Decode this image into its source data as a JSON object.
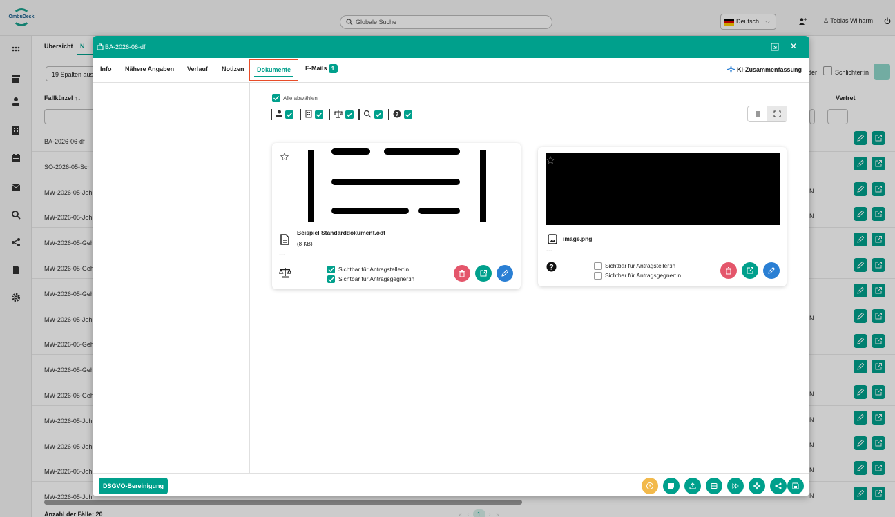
{
  "app": {
    "logo_text": "OmbuDesk"
  },
  "topbar": {
    "search_placeholder": "Globale Suche",
    "language": "Deutsch",
    "user_name": "Tobias Wilharm"
  },
  "list": {
    "tab_overview": "Übersicht",
    "tab_second": "N",
    "column_select": "19 Spalten aus",
    "col_fallkuerzel": "Fallkürzel ↑↓",
    "col_vertreter": "Vertret",
    "filter_der": "der",
    "filter_schlichter": "Schlichter:in",
    "rows": [
      "BA-2026-06-df",
      "SO-2026-05-Sch",
      "MW-2026-05-Joh",
      "MW-2026-05-Joh",
      "MW-2026-05-Geh",
      "MW-2026-05-Geh",
      "MW-2026-05-Geh",
      "MW-2026-05-Joh",
      "MW-2026-05-Geh",
      "MW-2026-05-Geh",
      "MW-2026-05-Geh",
      "MW-2026-05-Joh",
      "MW-2026-05-Joh",
      "MW-2026-05-Joh",
      "MW-2026-05-Joh"
    ],
    "n_mark": "N",
    "count_label": "Anzahl der Fälle: 20",
    "page_current": "1"
  },
  "modal": {
    "title": "BA-2026-06-df",
    "tabs": {
      "info": "Info",
      "details": "Nähere Angaben",
      "history": "Verlauf",
      "notes": "Notizen",
      "documents": "Dokumente",
      "emails": "E-Mails",
      "emails_count": "1"
    },
    "ki_summary": "KI-Zusammenfassung",
    "select_all": "Alle abwählen",
    "dsgvo_button": "DSGVO-Bereinigung",
    "documents": [
      {
        "name": "Beispiel Standarddokument.odt",
        "size": "(8 KB)",
        "note": "---",
        "visible_applicant_label": "Sichtbar für Antragsteller:in",
        "visible_applicant": true,
        "visible_opponent_label": "Sichtbar für Antragsgegner:in",
        "visible_opponent": true,
        "category_icon": "scale-icon"
      },
      {
        "name": "image.png",
        "size": "",
        "note": "---",
        "visible_applicant_label": "Sichtbar für Antragsteller:in",
        "visible_applicant": false,
        "visible_opponent_label": "Sichtbar für Antragsgegner:in",
        "visible_opponent": false,
        "category_icon": "question-icon"
      }
    ]
  },
  "colors": {
    "accent": "#00a08c",
    "danger": "#e4566b",
    "blue": "#2a7fd4",
    "highlight": "#e84c28",
    "orange": "#f2b94b"
  }
}
